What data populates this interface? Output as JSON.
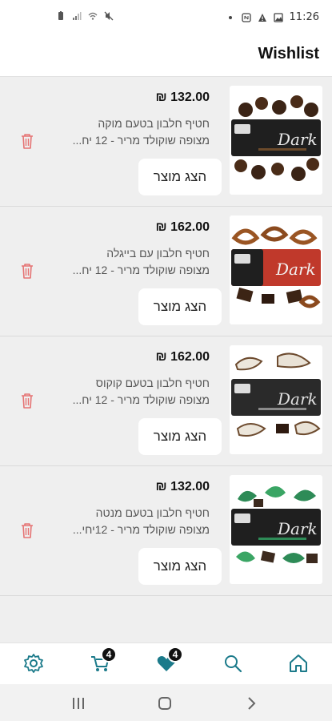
{
  "status_bar": {
    "time": "11:26",
    "left_icons": [
      "battery-icon",
      "signal-icon",
      "wifi-icon",
      "mute-icon"
    ],
    "right_icons": [
      "dot-icon",
      "nfc-icon",
      "alert-icon",
      "image-icon"
    ]
  },
  "header": {
    "title": "Wishlist"
  },
  "items": [
    {
      "price": "132.00 ₪",
      "title_line1": "חטיף חלבון בטעם מוקה",
      "title_line2": "מצופה שוקולד מריר - 12 יח...",
      "button": "הצג מוצר",
      "image": "mocha-protein-bar-image",
      "accent": "#3b2416",
      "accent2": "#5a3218"
    },
    {
      "price": "162.00 ₪",
      "title_line1": "חטיף חלבון עם בייגלה",
      "title_line2": "מצופה שוקולד מריר - 12 יח...",
      "button": "הצג מוצר",
      "image": "pretzel-protein-bar-image",
      "accent": "#c0392b",
      "accent2": "#8b4a1e"
    },
    {
      "price": "162.00 ₪",
      "title_line1": "חטיף חלבון  בטעם קוקוס",
      "title_line2": "מצופה שוקולד מריר - 12 יח...",
      "button": "הצג מוצר",
      "image": "coconut-protein-bar-image",
      "accent": "#7a7a7a",
      "accent2": "#e9e2d6"
    },
    {
      "price": "132.00 ₪",
      "title_line1": "חטיף חלבון בטעם מנטה",
      "title_line2": "מצופה שוקולד מריר - 12יחי...",
      "button": "הצג מוצר",
      "image": "mint-protein-bar-image",
      "accent": "#2e8b57",
      "accent2": "#3c2a1e"
    }
  ],
  "tabbar": {
    "cart_count": "4",
    "wishlist_count": "4",
    "accent": "#1b7a8a"
  },
  "trash_color": "#e57373"
}
